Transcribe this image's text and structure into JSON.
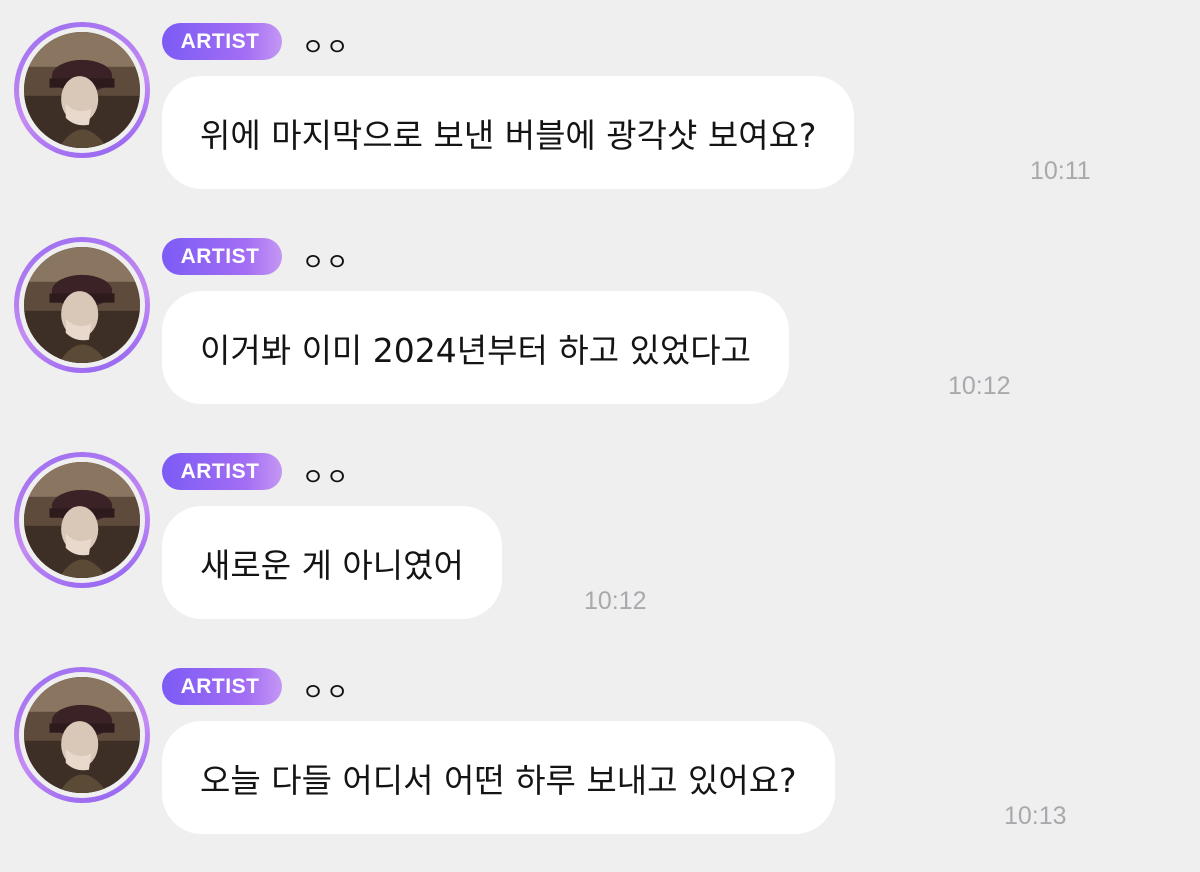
{
  "messages": [
    {
      "badge": "ARTIST",
      "sender": "ㅇㅇ",
      "text": "위에 마지막으로 보낸 버블에 광각샷 보여요?",
      "time": "10:11"
    },
    {
      "badge": "ARTIST",
      "sender": "ㅇㅇ",
      "text": "이거봐 이미 2024년부터 하고 있었다고",
      "time": "10:12"
    },
    {
      "badge": "ARTIST",
      "sender": "ㅇㅇ",
      "text": "새로운 게 아니였어",
      "time": "10:12"
    },
    {
      "badge": "ARTIST",
      "sender": "ㅇㅇ",
      "text": "오늘 다들 어디서 어떤 하루 보내고 있어요?",
      "time": "10:13"
    }
  ],
  "colors": {
    "background": "#efeff0",
    "bubble": "#ffffff",
    "badge_start": "#7c5bf5",
    "badge_end": "#c497f4",
    "time_text": "#a9a9ad"
  },
  "icons": {
    "avatar": "artist-profile-photo"
  }
}
